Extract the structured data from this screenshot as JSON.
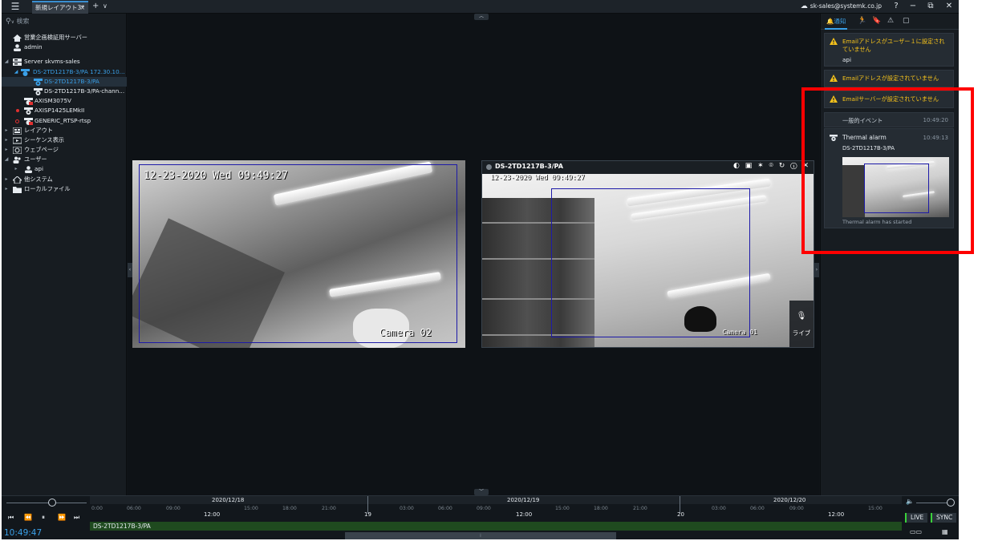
{
  "titlebar": {
    "tab_label": "新規レイアウト3*",
    "tab_close": "×",
    "add_tab": "+",
    "tab_menu": "∨",
    "account": "sk-sales@systemk.co.jp",
    "help": "?",
    "minimize": "−",
    "restore": "⧉",
    "close": "✕"
  },
  "left": {
    "search_placeholder": "検索",
    "tree": [
      {
        "label": "営業企画検証用サーバー",
        "icon": "home-icon"
      },
      {
        "label": "admin",
        "icon": "user-icon"
      },
      {
        "label": "Server skvms-sales",
        "icon": "server-icon"
      },
      {
        "label": "DS-2TD1217B-3/PA 172.30.10...",
        "icon": "camera-group-icon"
      },
      {
        "label": "DS-2TD1217B-3/PA",
        "icon": "camera-icon"
      },
      {
        "label": "DS-2TD1217B-3/PA-chann...",
        "icon": "camera-icon"
      },
      {
        "label": "AXISM3075V",
        "icon": "camera-offline-icon"
      },
      {
        "label": "AXISP1425LEMkII",
        "icon": "camera-icon"
      },
      {
        "label": "GENERIC_RTSP-rtsp",
        "icon": "camera-offline-icon"
      },
      {
        "label": "レイアウト",
        "icon": "layout-icon"
      },
      {
        "label": "シーケンス表示",
        "icon": "sequence-icon"
      },
      {
        "label": "ウェブページ",
        "icon": "webpage-icon"
      },
      {
        "label": "ユーザー",
        "icon": "users-icon"
      },
      {
        "label": "api",
        "icon": "user-icon"
      },
      {
        "label": "他システム",
        "icon": "other-system-icon"
      },
      {
        "label": "ローカルファイル",
        "icon": "folder-icon"
      }
    ]
  },
  "viewer": {
    "cam1": {
      "osd_time": "12-23-2020 Wed 09:49:27",
      "osd_name": "Camera 02"
    },
    "cam2": {
      "title": "DS-2TD1217B-3/PA",
      "osd_time": "12-23-2020 Wed 09:49:27",
      "osd_name": "Camera 01",
      "live_label": "ライブ"
    }
  },
  "right": {
    "tab_notify": "通知",
    "notices": [
      {
        "message": "Emailアドレスがユーザー１に設定されていません",
        "sub": "api"
      },
      {
        "message": "Emailアドレスが設定されていません",
        "sub": ""
      },
      {
        "message": "Emailサーバーが設定されていません",
        "sub": ""
      }
    ],
    "general_event": {
      "label": "一般的イベント",
      "time": "10:49:20"
    },
    "event": {
      "title": "Thermal alarm",
      "time": "10:49:13",
      "source": "DS-2TD1217B-3/PA",
      "footer": "Thermal alarm has started"
    }
  },
  "timeline": {
    "clock": "10:49:47",
    "dates": [
      "2020/12/18",
      "2020/12/19",
      "2020/12/20"
    ],
    "track_label": "DS-2TD1217B-3/PA",
    "live_button": "LIVE",
    "sync_button": "SYNC",
    "hours": [
      "0:00",
      "06:00",
      "09:00",
      "12:00",
      "15:00",
      "18:00",
      "21:00",
      "19",
      "03:00",
      "06:00",
      "09:00",
      "12:00",
      "15:00",
      "18:00",
      "21:00",
      "20",
      "03:00",
      "06:00",
      "09:00",
      "12:00",
      "15:00"
    ]
  },
  "colors": {
    "accent": "#3aa0e8",
    "warning": "#f5c21b",
    "highlight": "#ff0000",
    "live_green": "#3ad13a"
  }
}
